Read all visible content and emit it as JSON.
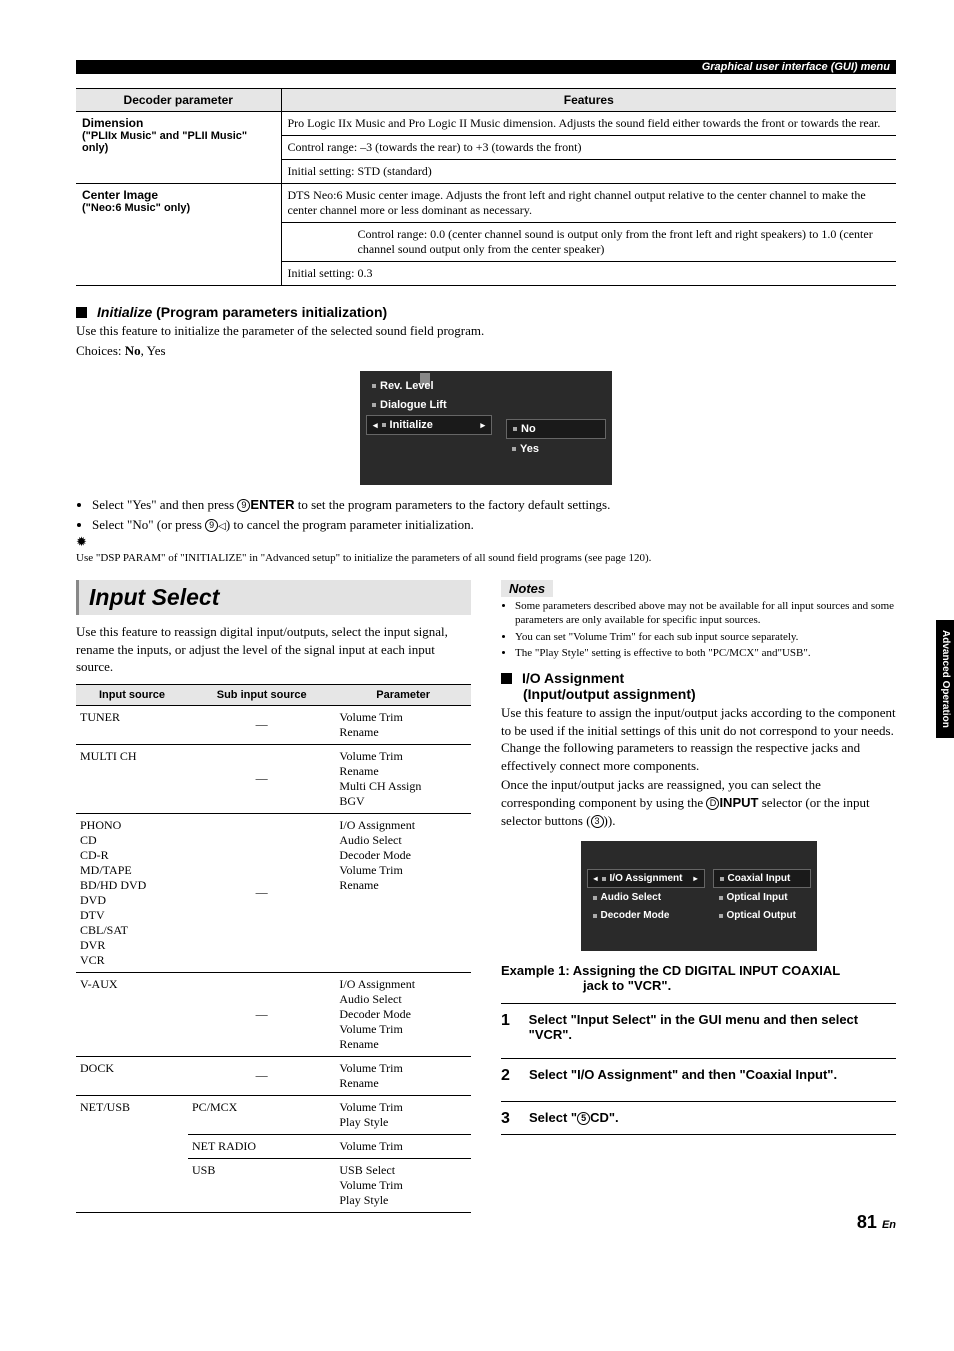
{
  "header_strip": "Graphical user interface (GUI) menu",
  "t1": {
    "h1": "Decoder parameter",
    "h2": "Features",
    "r1_param": "Dimension",
    "r1_sub": "(\"PLIIx Music\" and \"PLII Music\" only)",
    "r1a": "Pro Logic IIx Music and Pro Logic II Music dimension. Adjusts the sound field either towards the front or towards the rear.",
    "r1b": "Control range: –3 (towards the rear) to +3 (towards the front)",
    "r1c": "Initial setting: STD (standard)",
    "r2_param": "Center Image",
    "r2_sub": "(\"Neo:6 Music\" only)",
    "r2a": "DTS Neo:6 Music center image. Adjusts the front left and right channel output relative to the center channel to make the center channel more or less dominant as necessary.",
    "r2b": "Control range: 0.0 (center channel sound is output only from the front left and right speakers) to 1.0 (center channel sound output only from the center speaker)",
    "r2c": "Initial setting: 0.3"
  },
  "init": {
    "heading_bold": "Initialize",
    "heading_rest": "(Program parameters initialization)",
    "p1": "Use this feature to initialize the parameter of the selected sound field program.",
    "p2a": "Choices: ",
    "p2b": "No",
    "p2c": ", Yes",
    "menu": {
      "i1": "Rev. Level",
      "i2": "Dialogue Lift",
      "i3": "Initialize",
      "o1": "No",
      "o2": "Yes"
    },
    "b1a": "Select \"Yes\" and then press ",
    "b1b": "ENTER",
    "b1c": " to set the program parameters to the factory default settings.",
    "b2a": "Select \"No\" (or press ",
    "b2b": ") to cancel the program parameter initialization.",
    "tip": "Use \"DSP PARAM\" of \"INITIALIZE\" in \"Advanced setup\" to initialize the parameters of all sound field programs (see page 120)."
  },
  "inputselect": {
    "heading": "Input Select",
    "p": "Use this feature to reassign digital input/outputs, select the input signal, rename the inputs, or adjust the level of the signal input at each input source.",
    "th1": "Input source",
    "th2": "Sub input source",
    "th3": "Parameter",
    "rows": [
      {
        "src": "TUNER",
        "sub": "—",
        "param": "Volume Trim\nRename"
      },
      {
        "src": "MULTI CH",
        "sub": "—",
        "param": "Volume Trim\nRename\nMulti CH Assign\nBGV"
      },
      {
        "src": "PHONO\nCD\nCD-R\nMD/TAPE\nBD/HD DVD\nDVD\nDTV\nCBL/SAT\nDVR\nVCR",
        "sub": "—",
        "param": "I/O Assignment\nAudio Select\nDecoder Mode\nVolume Trim\nRename"
      },
      {
        "src": "V-AUX",
        "sub": "—",
        "param": "I/O Assignment\nAudio Select\nDecoder Mode\nVolume Trim\nRename"
      },
      {
        "src": "DOCK",
        "sub": "—",
        "param": "Volume Trim\nRename"
      }
    ],
    "netusb": {
      "src": "NET/USB",
      "r1": {
        "sub": "PC/MCX",
        "param": "Volume Trim\nPlay Style"
      },
      "r2": {
        "sub": "NET RADIO",
        "param": "Volume Trim"
      },
      "r3": {
        "sub": "USB",
        "param": "USB Select\nVolume Trim\nPlay Style"
      }
    }
  },
  "notes": {
    "label": "Notes",
    "n1": "Some parameters described above may not be available for all input sources and some parameters are only available for specific input sources.",
    "n2": "You can set \"Volume Trim\" for each sub input source separately.",
    "n3": "The \"Play Style\" setting is effective to both \"PC/MCX\" and\"USB\"."
  },
  "io": {
    "h1": "I/O Assignment",
    "h2": "(Input/output assignment)",
    "p1": "Use this feature to assign the input/output jacks according to the component to be used if the initial settings of this unit do not correspond to your needs. Change the following parameters to reassign the respective jacks and effectively connect more components.",
    "p2a": "Once the input/output jacks are reassigned, you can select the corresponding component by using the ",
    "p2b": "INPUT",
    "p2c": " selector (or the input selector buttons (",
    "p2d": ")).",
    "menu": {
      "l1": "I/O Assignment",
      "l2": "Audio Select",
      "l3": "Decoder Mode",
      "r1": "Coaxial Input",
      "r2": "Optical Input",
      "r3": "Optical Output"
    },
    "ex_a": "Example 1: Assigning the CD DIGITAL INPUT COAXIAL",
    "ex_b": "jack to \"VCR\".",
    "s1": "Select \"Input Select\" in the GUI menu and then select \"VCR\".",
    "s2": "Select \"I/O Assignment\" and then \"Coaxial Input\".",
    "s3a": "Select \"",
    "s3b": "CD\"."
  },
  "circled": {
    "nine": "9",
    "three": "3",
    "five": "5",
    "d": "D"
  },
  "sidetab": "Advanced Operation",
  "page": "81",
  "page_suffix": "En"
}
